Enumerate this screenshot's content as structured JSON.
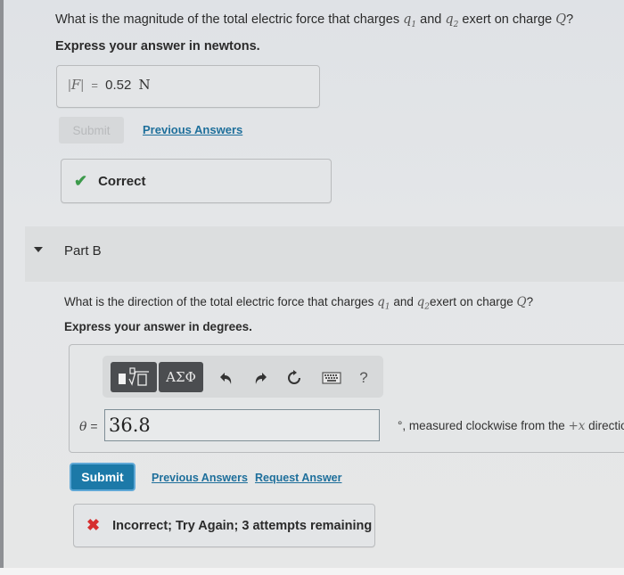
{
  "part_a": {
    "question_pre": "What is the magnitude of the total electric force that charges ",
    "q1": "q",
    "q1_sub": "1",
    "and": " and ",
    "q2": "q",
    "q2_sub": "2",
    "question_post": " exert on charge ",
    "Q": "Q",
    "qmark": "?",
    "instruction": "Express your answer in newtons.",
    "answer": {
      "variable": "F",
      "equals": "=",
      "value": "0.52",
      "unit": "N"
    },
    "submit_label": "Submit",
    "previous_answers_label": "Previous Answers",
    "feedback": {
      "icon": "check-icon",
      "text": "Correct",
      "color": "#3c9a4b"
    }
  },
  "part_b": {
    "header": "Part B",
    "question_pre": "What is the direction of the total electric force that charges ",
    "q1": "q",
    "q1_sub": "1",
    "and": " and ",
    "q2": "q",
    "q2_sub": "2",
    "question_post": "exert on charge ",
    "Q": "Q",
    "qmark": "?",
    "instruction": "Express your answer in degrees.",
    "toolbar": {
      "templates_icon": "fraction-root-templates-icon",
      "greek_label": "ΑΣΦ",
      "undo_icon": "undo-icon",
      "redo_icon": "redo-icon",
      "reset_icon": "reset-icon",
      "keyboard_icon": "keyboard-icon",
      "help_label": "?"
    },
    "input": {
      "variable": "θ",
      "equals": "=",
      "value": "36.8"
    },
    "unit_suffix_pre": "°, measured clockwise from the ",
    "unit_suffix_plus": "+",
    "unit_suffix_x": "x",
    "unit_suffix_post": " directio",
    "submit_label": "Submit",
    "previous_answers_label": "Previous Answers",
    "request_answer_label": "Request Answer",
    "feedback": {
      "icon": "x-icon",
      "text": "Incorrect; Try Again; 3 attempts remaining",
      "color": "#d62f2f"
    }
  },
  "colors": {
    "link": "#1e6f9b",
    "submit_bg": "#1c79a8",
    "correct": "#3c9a4b",
    "incorrect": "#d62f2f"
  }
}
